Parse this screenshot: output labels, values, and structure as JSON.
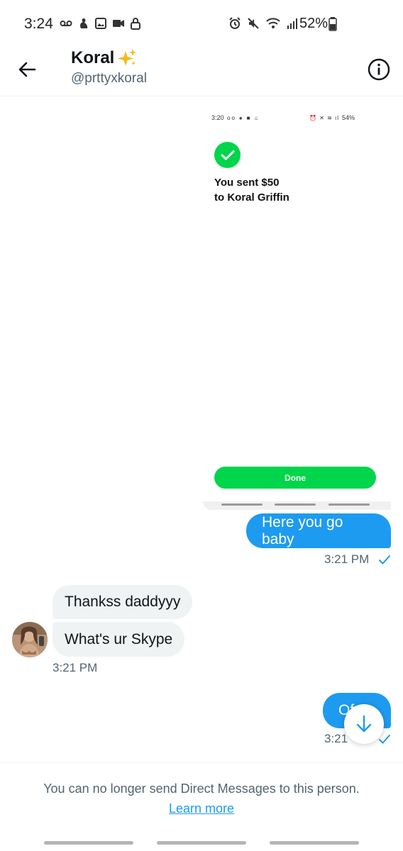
{
  "status_bar": {
    "time": "3:24",
    "left_icons": [
      "voicemail-icon",
      "notification-icon",
      "gallery-icon",
      "video-icon",
      "lock-icon"
    ],
    "right_icons": [
      "alarm-icon",
      "mute-icon",
      "wifi-icon",
      "signal-icon"
    ],
    "battery_percent": "52%"
  },
  "header": {
    "name": "Koral",
    "name_emoji": "✨",
    "handle": "@prttyxkoral"
  },
  "attachment": {
    "mini_status_time": "3:20",
    "mini_status_icons_left": "oo ♠ ■ ⌂",
    "mini_status_icons_right": "⏰ ✕ ≋ ıl",
    "mini_battery": "54%",
    "sent_line1": "You sent $50",
    "sent_line2": "to Koral Griffin",
    "done_label": "Done"
  },
  "messages": [
    {
      "direction": "out",
      "text": "Here you go baby",
      "time": "3:21 PM"
    },
    {
      "direction": "in",
      "text": "Thankss daddyyy"
    },
    {
      "direction": "in",
      "text": "What's ur Skype",
      "time": "3:21 PM"
    },
    {
      "direction": "out",
      "text": "Of",
      "time": "3:21"
    }
  ],
  "footer": {
    "notice": "You can no longer send Direct Messages to this person.",
    "learn_more": "Learn more"
  },
  "colors": {
    "accent": "#1d9bf0",
    "incoming_bubble": "#eff3f4",
    "secondary_text": "#536471",
    "cashapp_green": "#00d54b"
  }
}
